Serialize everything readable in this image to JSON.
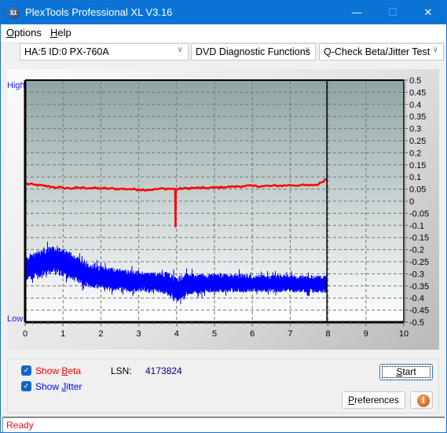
{
  "window": {
    "title": "PlexTools Professional XL V3.16",
    "app_icon": "XL",
    "minimize_icon": "—",
    "maximize_icon": "☐",
    "close_icon": "✕"
  },
  "menu": {
    "items": [
      {
        "label": "Options",
        "mnemonic": "O",
        "rest": "ptions"
      },
      {
        "label": "Help",
        "mnemonic": "H",
        "rest": "elp"
      }
    ]
  },
  "toolbar": {
    "drive_select": "HA:5 ID:0  PX-760A",
    "function_select": "DVD Diagnostic Functions",
    "test_select": "Q-Check Beta/Jitter Test",
    "chevron": "∨"
  },
  "chart_data": {
    "type": "line",
    "title": "",
    "xlabel": "",
    "ylabel": "",
    "left_label_top": "High",
    "left_label_bottom": "Low",
    "xlim": [
      0,
      10
    ],
    "ylim": [
      -0.5,
      0.5
    ],
    "x_ticks": [
      "0",
      "1",
      "2",
      "3",
      "4",
      "5",
      "6",
      "7",
      "8",
      "9",
      "10"
    ],
    "y_ticks": [
      "0.5",
      "0.45",
      "0.4",
      "0.35",
      "0.3",
      "0.25",
      "0.2",
      "0.15",
      "0.1",
      "0.05",
      "0",
      "-0.05",
      "-0.1",
      "-0.15",
      "-0.2",
      "-0.25",
      "-0.3",
      "-0.35",
      "-0.4",
      "-0.45",
      "-0.5"
    ],
    "grid": true,
    "end_marker_x": 7.97,
    "series": [
      {
        "name": "Beta",
        "color": "#ff0000",
        "x": [
          0,
          0.25,
          0.5,
          0.75,
          1.0,
          1.25,
          1.5,
          1.75,
          2.0,
          2.25,
          2.5,
          2.75,
          3.0,
          3.25,
          3.5,
          3.75,
          3.96,
          3.97,
          3.98,
          4.25,
          4.5,
          4.75,
          5.0,
          5.25,
          5.5,
          5.75,
          6.0,
          6.25,
          6.5,
          6.75,
          7.0,
          7.25,
          7.5,
          7.75,
          7.95
        ],
        "y": [
          0.072,
          0.068,
          0.063,
          0.058,
          0.055,
          0.053,
          0.056,
          0.054,
          0.053,
          0.052,
          0.051,
          0.05,
          0.048,
          0.047,
          0.05,
          0.052,
          0.05,
          -0.105,
          0.05,
          0.053,
          0.055,
          0.054,
          0.056,
          0.058,
          0.06,
          0.062,
          0.063,
          0.062,
          0.063,
          0.064,
          0.066,
          0.066,
          0.065,
          0.07,
          0.092
        ]
      },
      {
        "name": "Jitter",
        "color": "#0000ff",
        "x": [
          0,
          0.25,
          0.5,
          0.75,
          1.0,
          1.25,
          1.5,
          1.75,
          2.0,
          2.25,
          2.5,
          2.75,
          3.0,
          3.25,
          3.5,
          3.75,
          4.0,
          4.25,
          4.5,
          4.75,
          5.0,
          5.25,
          5.5,
          5.75,
          6.0,
          6.25,
          6.5,
          6.75,
          7.0,
          7.25,
          7.5,
          7.75,
          7.97
        ],
        "y_center": [
          -0.285,
          -0.265,
          -0.25,
          -0.245,
          -0.255,
          -0.27,
          -0.295,
          -0.31,
          -0.315,
          -0.32,
          -0.325,
          -0.33,
          -0.33,
          -0.335,
          -0.335,
          -0.34,
          -0.365,
          -0.345,
          -0.34,
          -0.34,
          -0.338,
          -0.338,
          -0.338,
          -0.34,
          -0.34,
          -0.34,
          -0.34,
          -0.34,
          -0.34,
          -0.342,
          -0.342,
          -0.342,
          -0.345
        ],
        "y_spread": [
          0.04,
          0.045,
          0.048,
          0.05,
          0.05,
          0.048,
          0.045,
          0.042,
          0.04,
          0.04,
          0.04,
          0.038,
          0.036,
          0.036,
          0.036,
          0.04,
          0.045,
          0.04,
          0.035,
          0.035,
          0.032,
          0.032,
          0.032,
          0.032,
          0.03,
          0.03,
          0.03,
          0.03,
          0.03,
          0.03,
          0.03,
          0.03,
          0.03
        ]
      }
    ]
  },
  "controls": {
    "show_beta": {
      "label": "Show Beta",
      "prefix": "Show ",
      "mnemonic": "B",
      "rest": "eta",
      "checked": true,
      "color": "#ff0000"
    },
    "show_jitter": {
      "label": "Show Jitter",
      "prefix": "Show ",
      "mnemonic": "J",
      "rest": "itter",
      "checked": true,
      "color": "#0000ff"
    },
    "lsn_label": "LSN:",
    "lsn_value": "4173824",
    "start_button": {
      "mnemonic": "S",
      "rest": "tart"
    },
    "preferences_button": {
      "mnemonic": "P",
      "rest": "references"
    },
    "info_icon": "i",
    "check_glyph": "✓"
  },
  "status": {
    "text": "Ready"
  }
}
